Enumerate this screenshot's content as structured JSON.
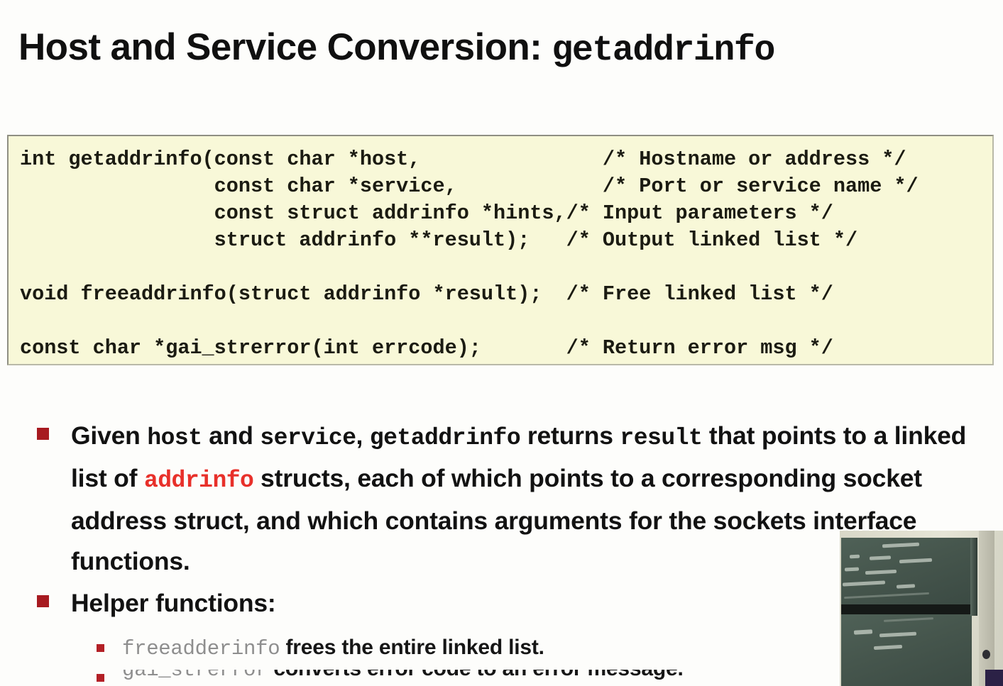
{
  "slide": {
    "title_plain": "Host and Service Conversion: ",
    "title_mono": "getaddrinfo",
    "background_color": "#fdfdfb"
  },
  "code_block": {
    "background_color": "#f8f8d8",
    "border_color": "#8f8f82",
    "text_color": "#1b1b12",
    "comment_color": "#e0403c",
    "lines": [
      {
        "code": "int getaddrinfo(const char *host,",
        "comment": "/* Hostname or address */",
        "comment_col": 48
      },
      {
        "code": "                const char *service,",
        "comment": "/* Port or service name */",
        "comment_col": 48
      },
      {
        "code": "                const struct addrinfo *hints,",
        "comment": "/* Input parameters */",
        "comment_col": 48
      },
      {
        "code": "                struct addrinfo **result);",
        "comment": "/* Output linked list */",
        "comment_col": 48
      },
      {
        "code": "",
        "comment": "",
        "comment_col": 0
      },
      {
        "code": "void freeaddrinfo(struct addrinfo *result);",
        "comment": "/* Free linked list */",
        "comment_col": 48
      },
      {
        "code": "",
        "comment": "",
        "comment_col": 0
      },
      {
        "code": "const char *gai_strerror(int errcode);",
        "comment": "/* Return error msg */",
        "comment_col": 48
      }
    ],
    "rendered_lines": [
      "int getaddrinfo(const char *host,               /* Hostname or address */",
      "                const char *service,            /* Port or service name */",
      "                const struct addrinfo *hints,/* Input parameters */",
      "                struct addrinfo **result);   /* Output linked list */",
      " ",
      "void freeaddrinfo(struct addrinfo *result);  /* Free linked list */",
      " ",
      "const char *gai_strerror(int errcode);       /* Return error msg */"
    ]
  },
  "bullets": {
    "marker_color": "#a71a20",
    "items": [
      {
        "id": "given-host-service",
        "segments": [
          {
            "text": "Given ",
            "style": "sans"
          },
          {
            "text": "host",
            "style": "mono"
          },
          {
            "text": " and ",
            "style": "sans"
          },
          {
            "text": "service",
            "style": "mono"
          },
          {
            "text": ", ",
            "style": "sans"
          },
          {
            "text": "getaddrinfo",
            "style": "mono"
          },
          {
            "text": " returns ",
            "style": "sans"
          },
          {
            "text": "result",
            "style": "mono"
          },
          {
            "text": " that points to a linked list of ",
            "style": "sans"
          },
          {
            "text": "addrinfo",
            "style": "mono-red"
          },
          {
            "text": " structs, each of which points to a corresponding socket address struct, and which contains arguments for the sockets interface functions.",
            "style": "sans"
          }
        ]
      },
      {
        "id": "helper-functions",
        "segments": [
          {
            "text": "Helper functions:",
            "style": "sans"
          }
        ],
        "sub_items": [
          {
            "id": "freeadderinfo",
            "segments": [
              {
                "text": "freeadderinfo",
                "style": "mono-gray"
              },
              {
                "text": " frees the entire linked list.",
                "style": "sans"
              }
            ]
          },
          {
            "id": "gai-strerror",
            "clipped": true,
            "segments": [
              {
                "text": "gai_strerror",
                "style": "mono-gray"
              },
              {
                "text": " converts error code to an error message.",
                "style": "sans"
              }
            ]
          }
        ]
      }
    ]
  },
  "video_overlay": {
    "label": "lecture-camera-feed",
    "description": "classroom chalkboard with handwritten chalk notes",
    "board_color": "#46564d",
    "wall_color": "#dcdbcb"
  },
  "colors": {
    "title": "#101010",
    "body_text": "#121212",
    "accent_red": "#e8302a",
    "bullet_red": "#a71a20",
    "mono_gray": "#8e8e8e",
    "code_bg": "#f8f8d8"
  }
}
